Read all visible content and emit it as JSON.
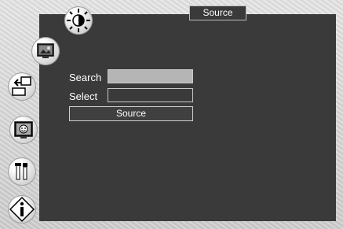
{
  "window": {
    "title": "Source"
  },
  "form": {
    "search_label": "Search",
    "select_label": "Select",
    "source_button_label": "Source"
  },
  "sidebar": {
    "icons": [
      {
        "name": "brightness-icon"
      },
      {
        "name": "picture-settings-icon"
      },
      {
        "name": "input-source-icon"
      },
      {
        "name": "display-face-icon"
      },
      {
        "name": "tools-icon"
      },
      {
        "name": "info-icon"
      }
    ]
  }
}
